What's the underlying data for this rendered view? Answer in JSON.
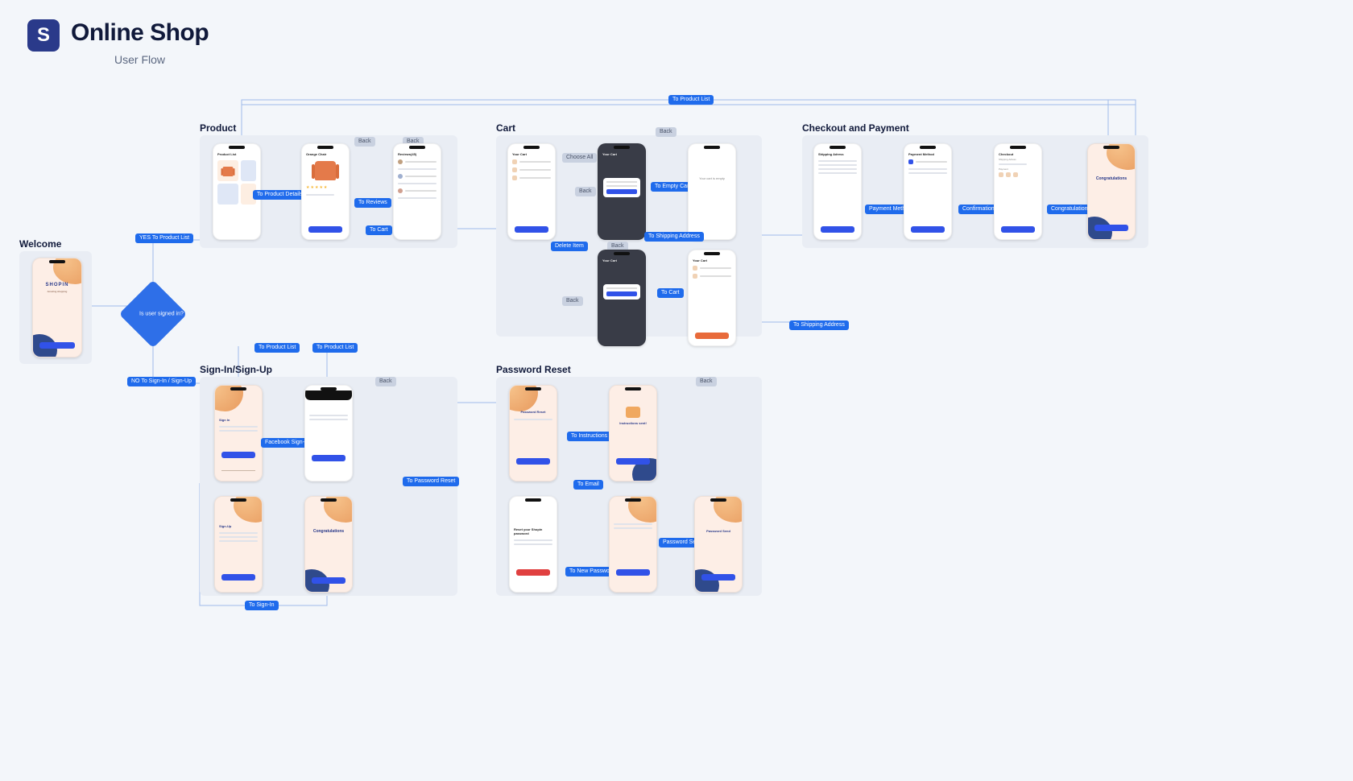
{
  "header": {
    "title": "Online Shop",
    "subtitle": "User Flow",
    "logo_letter": "S"
  },
  "sections": {
    "welcome": "Welcome",
    "product": "Product",
    "cart": "Cart",
    "checkout": "Checkout and Payment",
    "signin": "Sign-In/Sign-Up",
    "password": "Password Reset"
  },
  "decision": {
    "text": "Is user\nsigned in?"
  },
  "screens": {
    "welcome": {
      "brand": "SHOPIN",
      "tagline": "Amazing shopping"
    },
    "product_list": {
      "title": "Product List"
    },
    "product_detail": {
      "title": "Orange Chair"
    },
    "reviews": {
      "title": "Reviews(45)"
    },
    "your_cart": {
      "title": "Your Cart"
    },
    "cart_empty": {
      "text": "Your cart is empty"
    },
    "shipping": {
      "title": "Shipping Adress"
    },
    "payment_method": {
      "title": "Payment Method"
    },
    "checkout": {
      "title": "Checkout",
      "ship": "Shipping Adress",
      "pay": "Payment"
    },
    "congrats": {
      "title": "Congratulations"
    },
    "signin": {
      "title": "Sign In"
    },
    "signup": {
      "title": "Sign-Up"
    },
    "pwd_reset": {
      "title": "Password Reset"
    },
    "instr_sent": {
      "title": "Instructions sent!"
    },
    "reset_form": {
      "title": "Reset your Shopin password"
    },
    "pwd_sent": {
      "title": "Password Send"
    }
  },
  "edges": {
    "yes": "YES\nTo Product List",
    "no": "NO\nTo Sign-In / Sign-Up",
    "to_product_details": "To Product Details",
    "to_reviews": "To Reviews",
    "to_cart": "To Cart",
    "back": "Back",
    "choose_all": "Choose All",
    "to_empty_cart": "To Empty Cart",
    "delete_item": "Delete Item",
    "to_shipping": "To Shipping Address",
    "payment_method": "Payment Method",
    "confirmation": "Confirmation",
    "congratulations": "Congratulations",
    "to_product_list": "To Product List",
    "facebook_signin": "Facebook Sign-In",
    "to_password_reset": "To Password Reset",
    "to_signin": "To Sign-In",
    "to_instructions": "To Instructions",
    "to_email": "To Email",
    "to_new_password": "To New Password",
    "password_send": "Password Send"
  }
}
